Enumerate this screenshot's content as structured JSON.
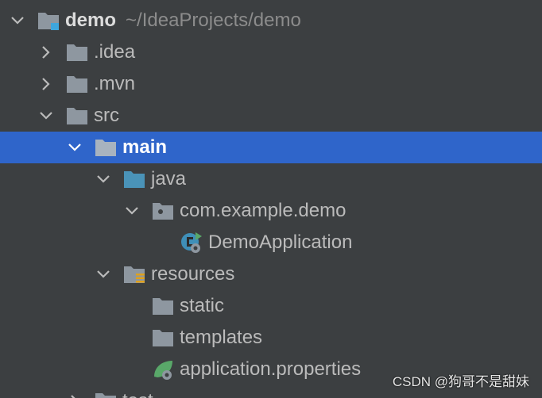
{
  "tree": {
    "root": {
      "name": "demo",
      "path": "~/IdeaProjects/demo"
    },
    "idea": {
      "label": ".idea"
    },
    "mvn": {
      "label": ".mvn"
    },
    "src": {
      "label": "src"
    },
    "main": {
      "label": "main"
    },
    "java": {
      "label": "java"
    },
    "package": {
      "label": "com.example.demo"
    },
    "app_class": {
      "label": "DemoApplication"
    },
    "resources": {
      "label": "resources"
    },
    "static": {
      "label": "static"
    },
    "templates": {
      "label": "templates"
    },
    "properties": {
      "label": "application.properties"
    },
    "test": {
      "label": "test"
    }
  },
  "watermark": "CSDN @狗哥不是甜妹",
  "colors": {
    "background": "#3c3f41",
    "selection": "#2f65ca",
    "folder": "#8e97a0",
    "source_folder": "#4a93b8"
  }
}
